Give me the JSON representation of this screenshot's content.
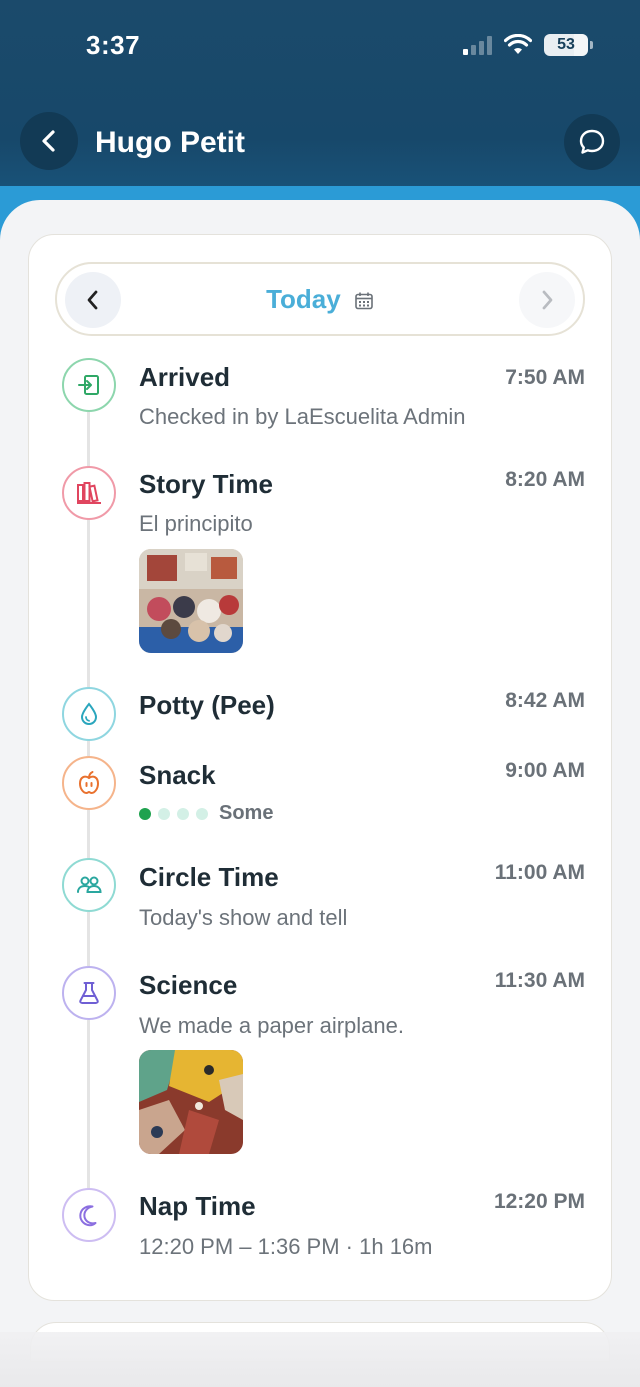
{
  "status_bar": {
    "time": "3:37",
    "battery": "53"
  },
  "header": {
    "title": "Hugo Petit"
  },
  "date_nav": {
    "label": "Today"
  },
  "colors": {
    "header_bg": "#17486a",
    "accent": "#4aaed8",
    "snack_dot": "#1fa24f"
  },
  "events": [
    {
      "title": "Arrived",
      "time": "7:50 AM",
      "subtitle": "Checked in by LaEscuelita Admin",
      "icon": "check-in-icon",
      "color": "#5cc28a"
    },
    {
      "title": "Story Time",
      "time": "8:20 AM",
      "subtitle": "El principito",
      "icon": "books-icon",
      "color": "#e8596f",
      "has_photo": true
    },
    {
      "title": "Potty (Pee)",
      "time": "8:42 AM",
      "icon": "water-drop-icon",
      "color": "#3fb7c9"
    },
    {
      "title": "Snack",
      "time": "9:00 AM",
      "amount": "Some",
      "amount_level": 1,
      "amount_max": 4,
      "icon": "apple-icon",
      "color": "#f08a4b"
    },
    {
      "title": "Circle Time",
      "time": "11:00 AM",
      "subtitle": "Today's show and tell",
      "icon": "group-icon",
      "color": "#3fb7b0"
    },
    {
      "title": "Science",
      "time": "11:30 AM",
      "subtitle": "We made a paper airplane.",
      "icon": "flask-icon",
      "color": "#8c7be0",
      "has_photo": true
    },
    {
      "title": "Nap Time",
      "time": "12:20 PM",
      "subtitle": "12:20 PM – 1:36 PM · 1h 16m",
      "icon": "moon-icon",
      "color": "#a98ae6"
    }
  ]
}
